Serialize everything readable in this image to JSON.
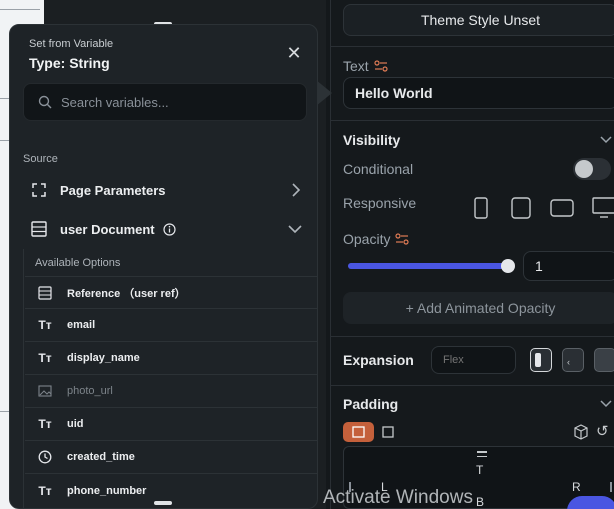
{
  "dialog": {
    "caption": "Set from Variable",
    "title": "Type: String",
    "search_placeholder": "Search variables...",
    "source_label": "Source",
    "rows": [
      {
        "label": "Page Parameters",
        "icon": "page-params-icon",
        "end_icon": "chevron-right-icon"
      },
      {
        "label": "user Document",
        "icon": "document-icon",
        "end_icon": "chevron-down-icon"
      }
    ],
    "options_title": "Available Options",
    "options": [
      {
        "label": "Reference （user ref）",
        "icon": "document-icon",
        "enabled": true
      },
      {
        "label": "email",
        "icon": "text-type-icon",
        "enabled": true
      },
      {
        "label": "display_name",
        "icon": "text-type-icon",
        "enabled": true
      },
      {
        "label": "photo_url",
        "icon": "image-icon",
        "enabled": false
      },
      {
        "label": "uid",
        "icon": "text-type-icon",
        "enabled": true
      },
      {
        "label": "created_time",
        "icon": "clock-icon",
        "enabled": true
      },
      {
        "label": "phone_number",
        "icon": "text-type-icon",
        "enabled": true
      }
    ]
  },
  "props": {
    "theme_style_button": "Theme Style Unset",
    "text_label": "Text",
    "text_value": "Hello World",
    "visibility_label": "Visibility",
    "conditional_label": "Conditional",
    "responsive_label": "Responsive",
    "opacity_label": "Opacity",
    "opacity_value": "1",
    "opacity_level": 1,
    "add_animated_opacity": "+ Add Animated Opacity",
    "expansion_label": "Expansion",
    "expansion_placeholder": "Flex",
    "padding_label": "Padding",
    "padding_top": "T",
    "padding_left": "L",
    "padding_right": "R",
    "padding_bottom": "B"
  },
  "watermark": "Activate Windows",
  "colors": {
    "accent_slider": "#4a56e2",
    "padding_active": "#c4603b"
  }
}
